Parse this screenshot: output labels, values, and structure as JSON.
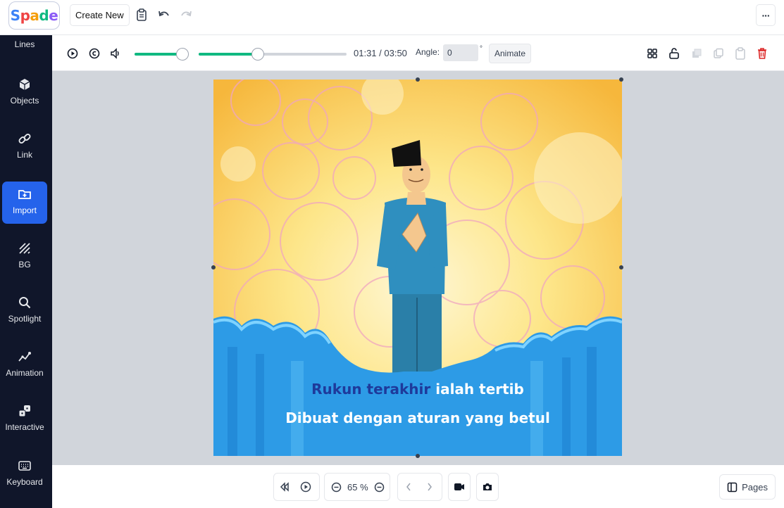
{
  "app": {
    "logo_text": "Spade"
  },
  "topbar": {
    "create_new_label": "Create New",
    "icons": [
      "clipboard-icon",
      "undo-icon",
      "redo-icon"
    ],
    "more_label": "···"
  },
  "sidebar": {
    "items": [
      {
        "label": "Lines",
        "icon": "lines-icon",
        "active": false
      },
      {
        "label": "Objects",
        "icon": "cube-icon",
        "active": false
      },
      {
        "label": "Link",
        "icon": "link-icon",
        "active": false
      },
      {
        "label": "Import",
        "icon": "import-icon",
        "active": true
      },
      {
        "label": "BG",
        "icon": "background-icon",
        "active": false
      },
      {
        "label": "Spotlight",
        "icon": "search-icon",
        "active": false
      },
      {
        "label": "Animation",
        "icon": "animation-icon",
        "active": false
      },
      {
        "label": "Interactive",
        "icon": "dice-icon",
        "active": false
      },
      {
        "label": "Keyboard",
        "icon": "keyboard-icon",
        "active": false
      }
    ]
  },
  "toolbar": {
    "volume_level": 0.95,
    "playback_progress": 0.4,
    "time_text": "01:31 / 03:50",
    "angle_label": "Angle:",
    "angle_value": "0",
    "degree_symbol": "°",
    "animate_label": "Animate",
    "right_icons": [
      "grid-icon",
      "lock-icon",
      "layers-icon",
      "copy-icon",
      "paste-icon",
      "trash-icon"
    ]
  },
  "stage": {
    "caption_line1_highlight": "Rukun terakhir",
    "caption_line1_rest": " ialah tertib",
    "caption_line2": "Dibuat dengan aturan yang betul"
  },
  "bottombar": {
    "zoom_text": "65 %",
    "pages_label": "Pages"
  },
  "colors": {
    "accent": "#2563eb",
    "sidebar_bg": "#10162a",
    "progress_green": "#10b981",
    "delete_red": "#dc2626"
  }
}
